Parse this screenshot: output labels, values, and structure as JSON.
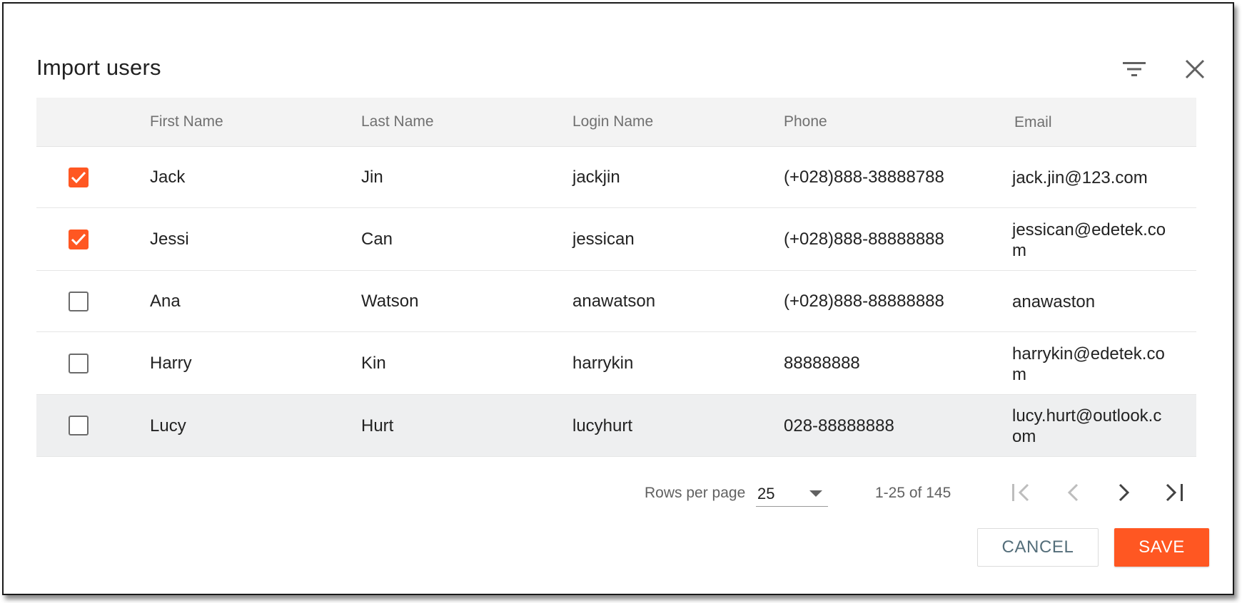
{
  "dialog": {
    "title": "Import users"
  },
  "columns": {
    "first_name": "First Name",
    "last_name": "Last Name",
    "login_name": "Login Name",
    "phone": "Phone",
    "email": "Email"
  },
  "rows": [
    {
      "checked": true,
      "first": "Jack",
      "last": "Jin",
      "login": "jackjin",
      "phone": "(+028)888-38888788",
      "email": "jack.jin@123.com"
    },
    {
      "checked": true,
      "first": "Jessi",
      "last": "Can",
      "login": "jessican",
      "phone": "(+028)888-88888888",
      "email": "jessican@edetek.com"
    },
    {
      "checked": false,
      "first": "Ana",
      "last": "Watson",
      "login": "anawatson",
      "phone": "(+028)888-88888888",
      "email": "anawaston"
    },
    {
      "checked": false,
      "first": "Harry",
      "last": "Kin",
      "login": "harrykin",
      "phone": "88888888",
      "email": "harrykin@edetek.com"
    },
    {
      "checked": false,
      "first": "Lucy",
      "last": "Hurt",
      "login": "lucyhurt",
      "phone": "028-88888888",
      "email": "lucy.hurt@outlook.com"
    }
  ],
  "pagination": {
    "rows_per_page_label": "Rows per page",
    "rows_per_page_value": "25",
    "range_text": "1-25 of 145"
  },
  "actions": {
    "cancel_label": "CANCEL",
    "save_label": "SAVE"
  },
  "colors": {
    "accent": "#ff5722",
    "header_bg": "#f3f3f3",
    "hover_row_bg": "#eeeff0",
    "cancel_text": "#546e7a"
  },
  "icons": {
    "filter": "filter-icon",
    "close": "close-icon",
    "check": "check-icon",
    "dropdown": "dropdown-arrow-icon",
    "first_page": "first-page-icon",
    "prev_page": "chevron-left-icon",
    "next_page": "chevron-right-icon",
    "last_page": "last-page-icon"
  }
}
